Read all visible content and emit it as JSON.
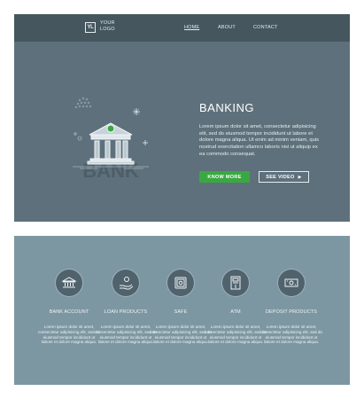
{
  "header": {
    "logo_mark": "YL",
    "logo_text": "YOUR\nLOGO",
    "nav": [
      {
        "label": "HOME",
        "active": true
      },
      {
        "label": "ABOUT",
        "active": false
      },
      {
        "label": "CONTACT",
        "active": false
      }
    ]
  },
  "hero": {
    "illustration_label": "BANK",
    "title": "BANKING",
    "body": "Lorem ipsum dolor sit amet, consectetur adipisicing elit, sed do eiusmod tempor incididunt ut labore et dolore magna aliqua. Ut enim ad minim veniam, quis nostrud exercitation ullamco laboris nisi ut aliquip ex ea commodo consequat.",
    "primary_button": "KNOW MORE",
    "secondary_button": "SEE VIDEO"
  },
  "features": [
    {
      "icon": "bank-icon",
      "title": "BANK ACCOUNT",
      "text": "Lorem ipsum dolor sit amet, consectetur adipisicing elit, sed do eiusmod tempor incididunt ut labore et dolore magna aliqua."
    },
    {
      "icon": "hand-coin-icon",
      "title": "LOAN PRODUCTS",
      "text": "Lorem ipsum dolor sit amet, consectetur adipisicing elit, sed do eiusmod tempor incididunt ut labore et dolore magna aliqua."
    },
    {
      "icon": "safe-icon",
      "title": "SAFE",
      "text": "Lorem ipsum dolor sit amet, consectetur adipisicing elit, sed do eiusmod tempor incididunt ut labore et dolore magna aliqua."
    },
    {
      "icon": "atm-icon",
      "title": "ATM",
      "text": "Lorem ipsum dolor sit amet, consectetur adipisicing elit, sed do eiusmod tempor incididunt ut labore et dolore magna aliqua."
    },
    {
      "icon": "banknote-icon",
      "title": "DEPOSIT PRODUCTS",
      "text": "Lorem ipsum dolor sit amet, consectetur adipisicing elit, sed do eiusmod tempor incididunt ut labore et dolore magna aliqua."
    }
  ],
  "colors": {
    "hero_bg": "#5e707b",
    "topbar_bg": "#45565f",
    "features_bg": "#7d97a2",
    "accent_green": "#3aa842"
  }
}
